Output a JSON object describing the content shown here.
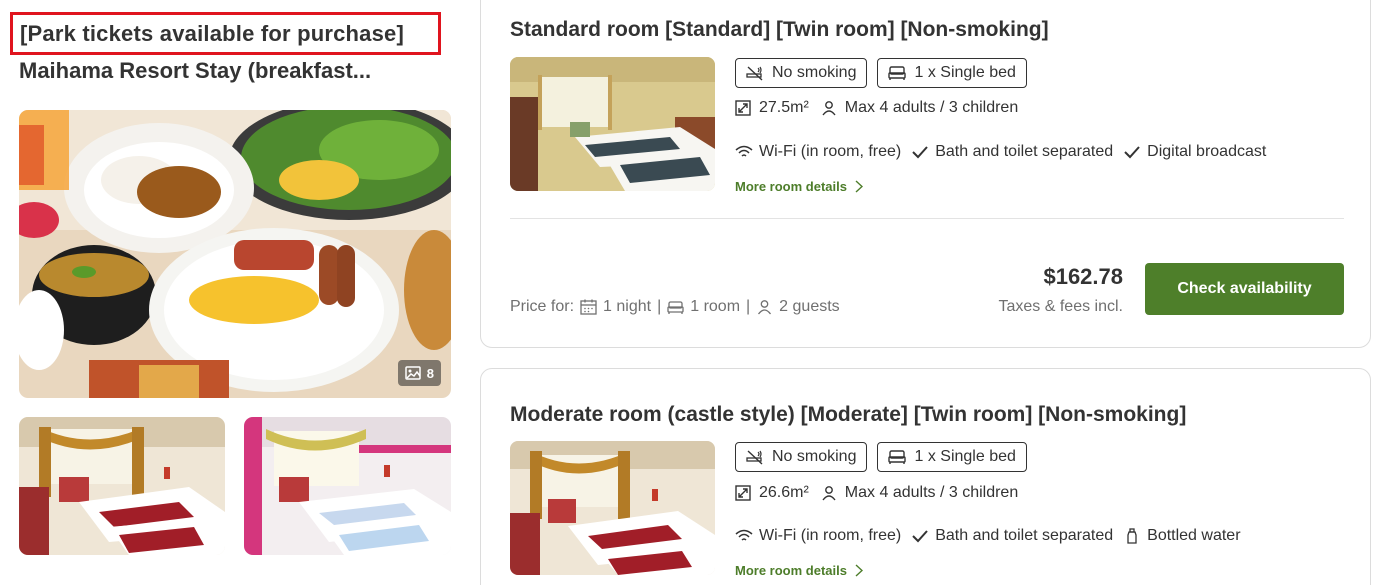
{
  "plan": {
    "tag": "[Park tickets available for purchase]",
    "title": "Maihama Resort Stay (breakfast...",
    "photo_count": "8",
    "colors": {
      "highlight": "#e0141e"
    }
  },
  "rooms": [
    {
      "title": "Standard room [Standard] [Twin room] [Non-smoking]",
      "chips": [
        {
          "icon": "no-smoking-icon",
          "label": "No smoking"
        },
        {
          "icon": "bed-icon",
          "label": "1 x Single bed"
        }
      ],
      "size": "27.5m²",
      "occupancy": "Max 4 adults / 3 children",
      "amenities": [
        {
          "icon": "wifi-icon",
          "label": "Wi-Fi (in room, free)"
        },
        {
          "icon": "check-icon",
          "label": "Bath and toilet separated"
        },
        {
          "icon": "check-icon",
          "label": "Digital broadcast"
        }
      ],
      "more_details": "More room details",
      "price_for_label": "Price for:",
      "nights": "1 night",
      "rooms": "1 room",
      "guests": "2 guests",
      "separator": "|",
      "price": "$162.78",
      "taxes": "Taxes & fees incl.",
      "cta": "Check availability"
    },
    {
      "title": "Moderate room (castle style) [Moderate] [Twin room] [Non-smoking]",
      "chips": [
        {
          "icon": "no-smoking-icon",
          "label": "No smoking"
        },
        {
          "icon": "bed-icon",
          "label": "1 x Single bed"
        }
      ],
      "size": "26.6m²",
      "occupancy": "Max 4 adults / 3 children",
      "amenities": [
        {
          "icon": "wifi-icon",
          "label": "Wi-Fi (in room, free)"
        },
        {
          "icon": "check-icon",
          "label": "Bath and toilet separated"
        },
        {
          "icon": "bottle-icon",
          "label": "Bottled water"
        }
      ],
      "more_details": "More room details"
    }
  ],
  "colors": {
    "primary_green": "#4e7f2a",
    "link_green": "#4d7d2a",
    "muted_text": "#707070",
    "text": "#333333"
  }
}
